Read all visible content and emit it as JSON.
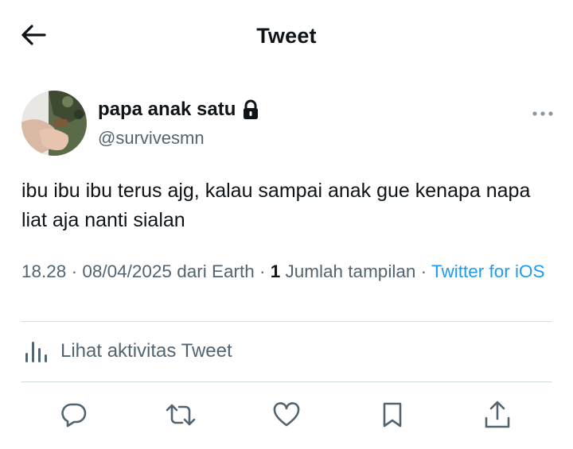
{
  "header": {
    "title": "Tweet",
    "back_icon": "arrow-left-icon"
  },
  "author": {
    "name": "papa anak satu",
    "handle": "@survivesmn",
    "protected_icon": "lock-icon",
    "avatar": "avatar"
  },
  "tweet": {
    "text": "ibu ibu ibu terus ajg, kalau sampai anak gue kenapa napa liat aja nanti sialan"
  },
  "meta": {
    "time": "18.28",
    "sep1": " · ",
    "date": "08/04/2025",
    "location": " dari Earth",
    "sep2": " · ",
    "views_count": "1",
    "views_label": " Jumlah tampilan",
    "sep3": " · ",
    "source": "Twitter for iOS"
  },
  "activity": {
    "label": "Lihat aktivitas Tweet",
    "icon": "bar-chart-icon"
  },
  "actions": {
    "reply_icon": "reply-icon",
    "retweet_icon": "retweet-icon",
    "like_icon": "heart-icon",
    "bookmark_icon": "bookmark-icon",
    "share_icon": "share-icon"
  },
  "colors": {
    "text": "#0f1419",
    "secondary": "#536471",
    "link": "#1d9bf0",
    "divider": "#cfd9de"
  }
}
